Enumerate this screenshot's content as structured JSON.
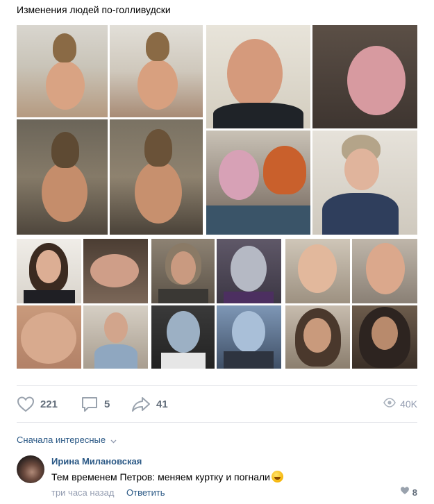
{
  "post": {
    "title": "Изменения людей по-голливудски"
  },
  "photos": [
    "thor-fat-suit-photo-1",
    "thor-fat-suit-photo-2",
    "robin-williams-portrait-photo",
    "robin-williams-makeup-photo",
    "thor-on-set-photo-1",
    "thor-on-set-photo-2",
    "mrs-doubtfire-makeup-photo",
    "mrs-doubtfire-costume-photo",
    "actress-portrait-photo",
    "actress-makeup-photo",
    "actor-portrait-photo",
    "white-walker-makeup-photo",
    "dwarf-bald-cap-photo",
    "dwarf-prosthetic-photo",
    "prosthetic-nose-photo",
    "bald-cap-costume-photo",
    "night-king-makeup-photo",
    "night-king-final-photo",
    "thorin-makeup-photo",
    "thorin-final-photo"
  ],
  "actions": {
    "likes": "221",
    "comments": "5",
    "shares": "41",
    "views": "40K",
    "icons": {
      "like": "heart-icon",
      "comment": "comment-icon",
      "share": "share-icon",
      "views": "eye-icon"
    }
  },
  "comments": {
    "sort_label": "Сначала интересные",
    "items": [
      {
        "author": "Ирина Милановская",
        "text": "Тем временем Петров: меняем куртку и погнали",
        "time": "три часа назад",
        "reply_label": "Ответить",
        "likes": "8"
      }
    ]
  },
  "colors": {
    "link": "#2a5885",
    "muted": "#939cb0",
    "action": "#626d7a",
    "divider": "#e7e8ec"
  }
}
